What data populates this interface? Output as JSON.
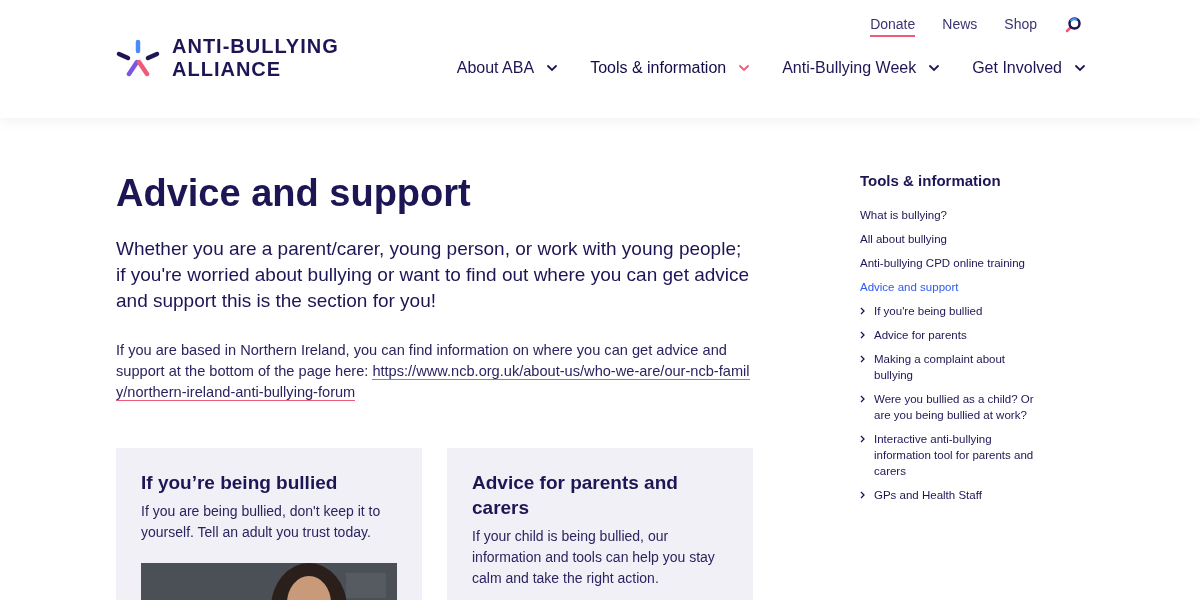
{
  "header": {
    "logo": {
      "line_1": "ANTI-BULLYING",
      "line_2": "ALLIANCE"
    },
    "utility_links": [
      {
        "label": "Donate",
        "underlined": true
      },
      {
        "label": "News",
        "underlined": false
      },
      {
        "label": "Shop",
        "underlined": false
      }
    ],
    "main_nav": [
      {
        "label": "About ABA",
        "selected": false
      },
      {
        "label": "Tools & information",
        "selected": true
      },
      {
        "label": "Anti-Bullying Week",
        "selected": false
      },
      {
        "label": "Get Involved",
        "selected": false
      }
    ]
  },
  "page": {
    "title": "Advice and support",
    "intro": "Whether you are a parent/carer, young person, or work with young people; if you're worried about bullying or want to find out where you can get advice and support this is the section for you!",
    "note": "If you are based in Northern Ireland, you can find information on where you can get advice and support at the bottom of the page here:",
    "note_link": "https://www.ncb.org.uk/about-us/who-we-are/our-ncb-family/northern-ireland-anti-bullying-forum",
    "cards": [
      {
        "title": "If you’re being bullied",
        "text": "If you are being bullied, don't keep it to yourself. Tell an adult you trust today.",
        "kind": "picture"
      },
      {
        "title": "Advice for parents and carers",
        "text": "If your child is being bullied, our information and tools can help you stay calm and take the right action."
      }
    ]
  },
  "sidebar": {
    "title": "Tools & information",
    "items": [
      {
        "label": "What is bullying?",
        "selected": false
      },
      {
        "label": "All about bullying",
        "selected": false
      },
      {
        "label": "Anti-bullying CPD online training",
        "selected": false
      },
      {
        "label": "Advice and support",
        "selected": true,
        "children": [
          {
            "label": "If you're being bullied",
            "selected": false
          },
          {
            "label": "Advice for parents",
            "selected": false
          },
          {
            "label": "Making a complaint about bullying",
            "selected": false
          },
          {
            "label": "Were you bullied as a child? Or are you being bullied at work?",
            "selected": false
          },
          {
            "label": "Interactive anti-bullying information tool for parents and carers",
            "selected": false
          },
          {
            "label": "GPs and Health Staff",
            "selected": false
          }
        ]
      }
    ]
  }
}
